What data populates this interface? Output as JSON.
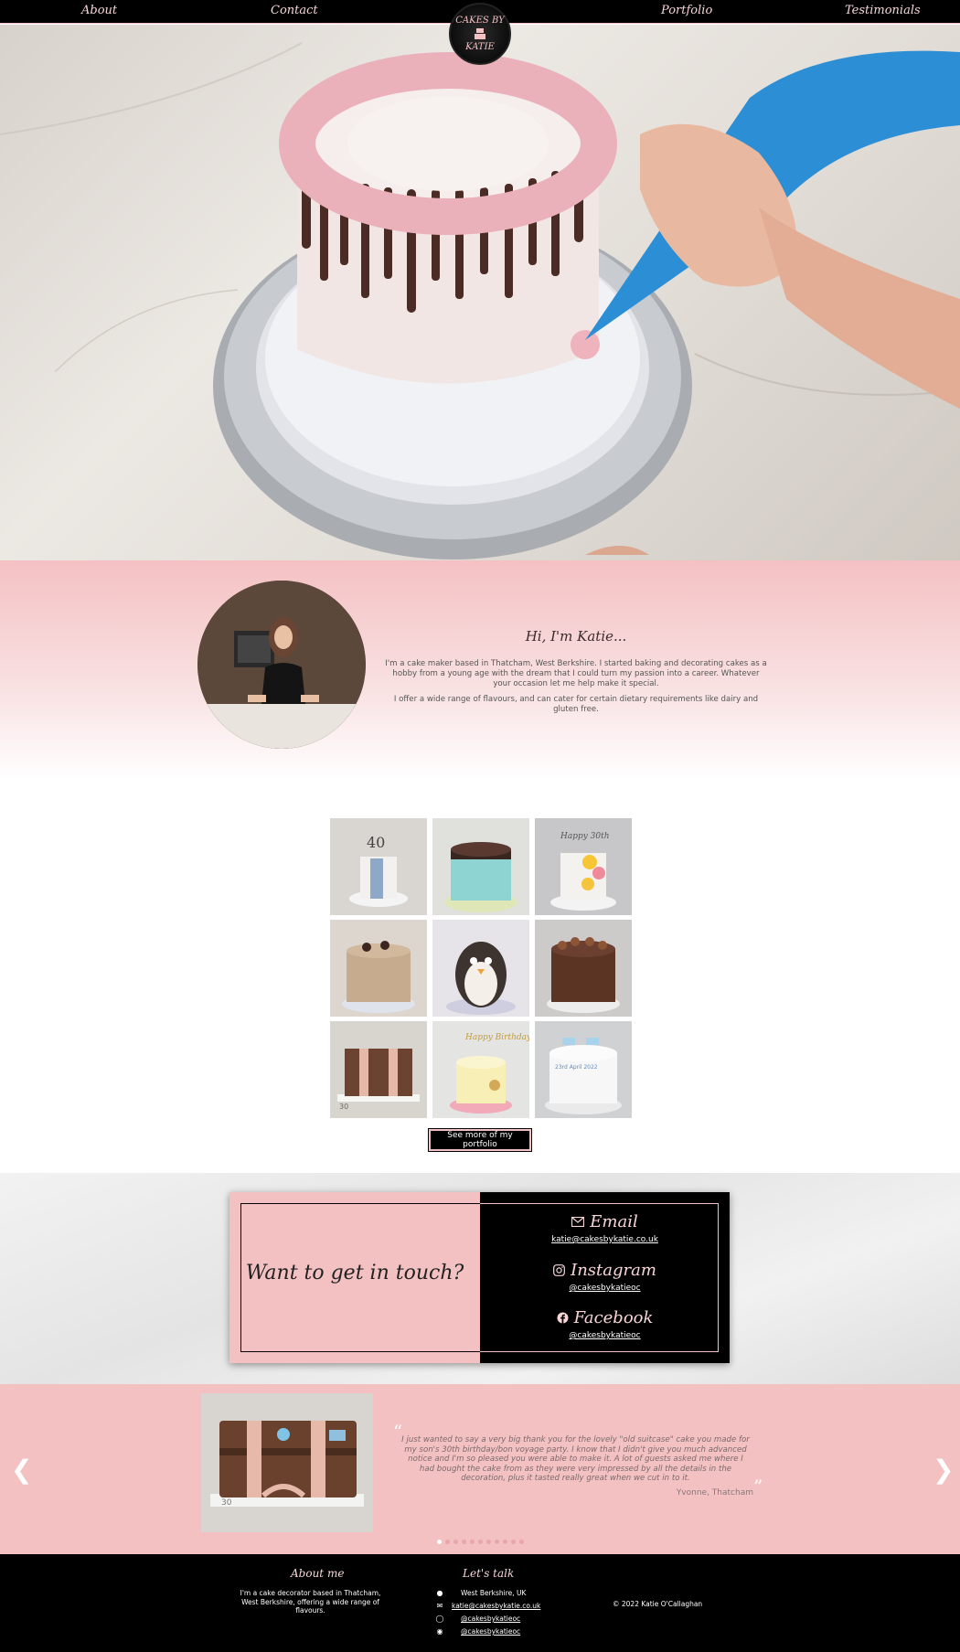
{
  "nav": {
    "items": [
      "About",
      "Contact",
      "Portfolio",
      "Testimonials"
    ],
    "logo_text_line1": "CAKES BY",
    "logo_text_line2": "KATIE"
  },
  "about": {
    "heading": "Hi, I'm Katie...",
    "para1": "I'm a cake maker based in Thatcham, West Berkshire. I started baking and decorating cakes as a hobby from a young age with the dream that I could turn my passion into a career. Whatever your occasion let me help make it special.",
    "para2": "I offer a wide range of flavours, and can cater for certain dietary requirements like dairy and gluten free."
  },
  "gallery": {
    "button_label": "See more of my portfolio",
    "tiles": [
      "40",
      "",
      "Happy 30th",
      "",
      "",
      "",
      "30",
      "Happy Birthday",
      "23rd April 2022"
    ]
  },
  "contact": {
    "heading": "Want to get in touch?",
    "email_label": "Email",
    "email_value": "katie@cakesbykatie.co.uk",
    "instagram_label": "Instagram",
    "instagram_value": "@cakesbykatieoc",
    "facebook_label": "Facebook",
    "facebook_value": "@cakesbykatieoc"
  },
  "testimonial": {
    "quote": "I just wanted to say a very big thank you for the lovely \"old suitcase\" cake you made for my son's 30th birthday/bon voyage party. I know that I didn't give you much advanced notice and I'm so pleased you were able to make it. A lot of guests asked me where I had bought the cake from as they were very impressed by all the details in the decoration, plus it tasted really great when we cut in to it.",
    "author": "Yvonne, Thatcham",
    "photo_label": "30",
    "dot_count": 11,
    "active_dot": 1
  },
  "footer": {
    "about_heading": "About me",
    "about_text": "I'm a cake decorator based in Thatcham, West Berkshire, offering a wide range of flavours.",
    "talk_heading": "Let's talk",
    "location": "West Berkshire, UK",
    "email": "katie@cakesbykatie.co.uk",
    "instagram": "@cakesbykatieoc",
    "facebook": "@cakesbykatieoc",
    "copyright": "© 2022 Katie O'Callaghan"
  },
  "colors": {
    "pink": "#f4c1c3",
    "black": "#000000",
    "light_pink_text": "#f8d6d7"
  }
}
